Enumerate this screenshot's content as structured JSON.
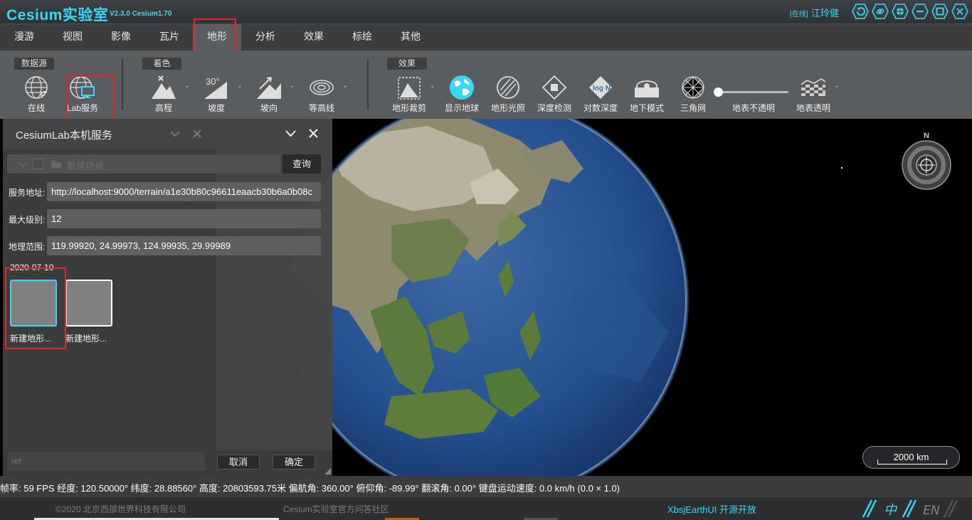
{
  "app": {
    "title": "Cesium实验室",
    "version": "V2.3.0  Cesium1.70",
    "user_status": "[在线]",
    "user_name": "江玲健"
  },
  "menu": [
    "漫游",
    "视图",
    "影像",
    "瓦片",
    "地形",
    "分析",
    "效果",
    "标绘",
    "其他"
  ],
  "menu_active": "地形",
  "toolbar": {
    "groups": {
      "datasource": "数据源",
      "coloring": "着色",
      "effects": "效果"
    },
    "datasource": [
      "在线",
      "Lab服务"
    ],
    "coloring": [
      "高程",
      "坡度",
      "坡向",
      "等高线"
    ],
    "effects": [
      "地形裁剪",
      "显示地球",
      "地形光照",
      "深度检测",
      "对数深度",
      "地下模式",
      "三角网",
      "地表不透明",
      "地表透明"
    ],
    "slope_text": "30°",
    "log_text": "log N"
  },
  "panel": {
    "title": "CesiumLab本机服务",
    "scene_placeholder": "新建场景",
    "query_label": "查询",
    "service_url_label": "服务地址:",
    "service_url": "http://localhost:9000/terrain/a1e30b80c96611eaacb30b6a0b08c",
    "max_level_label": "最大级别:",
    "max_level": "12",
    "geo_range_label": "地理范围:",
    "geo_range": "119.99920, 24.99973, 124.99935, 29.99989",
    "date": "2020-07-10",
    "items": [
      {
        "label": "新建地形..."
      },
      {
        "label": "新建地形..."
      }
    ],
    "ref_placeholder": "ref:",
    "cancel": "取消",
    "ok": "确定"
  },
  "compass": {
    "north": "N"
  },
  "scale": "2000 km",
  "status": "帧率: 59 FPS 经度: 120.50000° 纬度: 28.88560° 高度: 20803593.75米 偏航角: 360.00° 俯仰角: -89.99° 翻滚角: 0.00° 键盘运动速度: 0.0 km/h (0.0 × 1.0)",
  "footer": {
    "copyright": "©2020 北京西部世界科技有限公司",
    "community": "Cesium实验室官方问答社区",
    "open_source": "XbsjEarthUI 开源开放",
    "lang_cn": "中",
    "lang_en": "EN"
  },
  "colors": {
    "accent": "#3cd6f5",
    "highlight": "#e02828"
  }
}
